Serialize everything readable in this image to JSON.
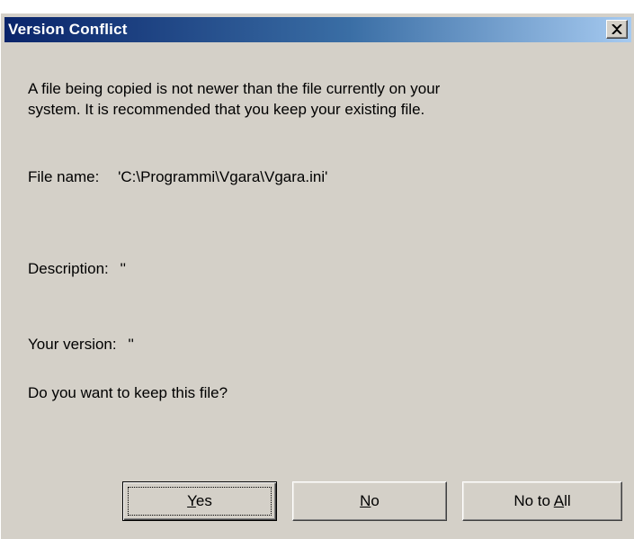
{
  "window": {
    "title": "Version Conflict",
    "close_symbol": "close-icon"
  },
  "message": {
    "line1": "A file being copied is not newer than the file currently on your",
    "line2": "system. It is recommended that you keep your existing file."
  },
  "fields": {
    "file_name_label": "File name:",
    "file_name_value": "'C:\\Programmi\\Vgara\\Vgara.ini'",
    "description_label": "Description:",
    "description_value": "''",
    "version_label": "Your version:",
    "version_value": "''"
  },
  "question": "Do you want to keep this file?",
  "buttons": {
    "yes": {
      "accel": "Y",
      "rest": "es"
    },
    "no": {
      "accel": "N",
      "rest": "o"
    },
    "no_to_all": {
      "pre": "No to ",
      "accel": "A",
      "rest": "ll"
    }
  },
  "colors": {
    "titlebar_start": "#0a246a",
    "titlebar_end": "#a6caf0",
    "face": "#d4d0c8"
  }
}
